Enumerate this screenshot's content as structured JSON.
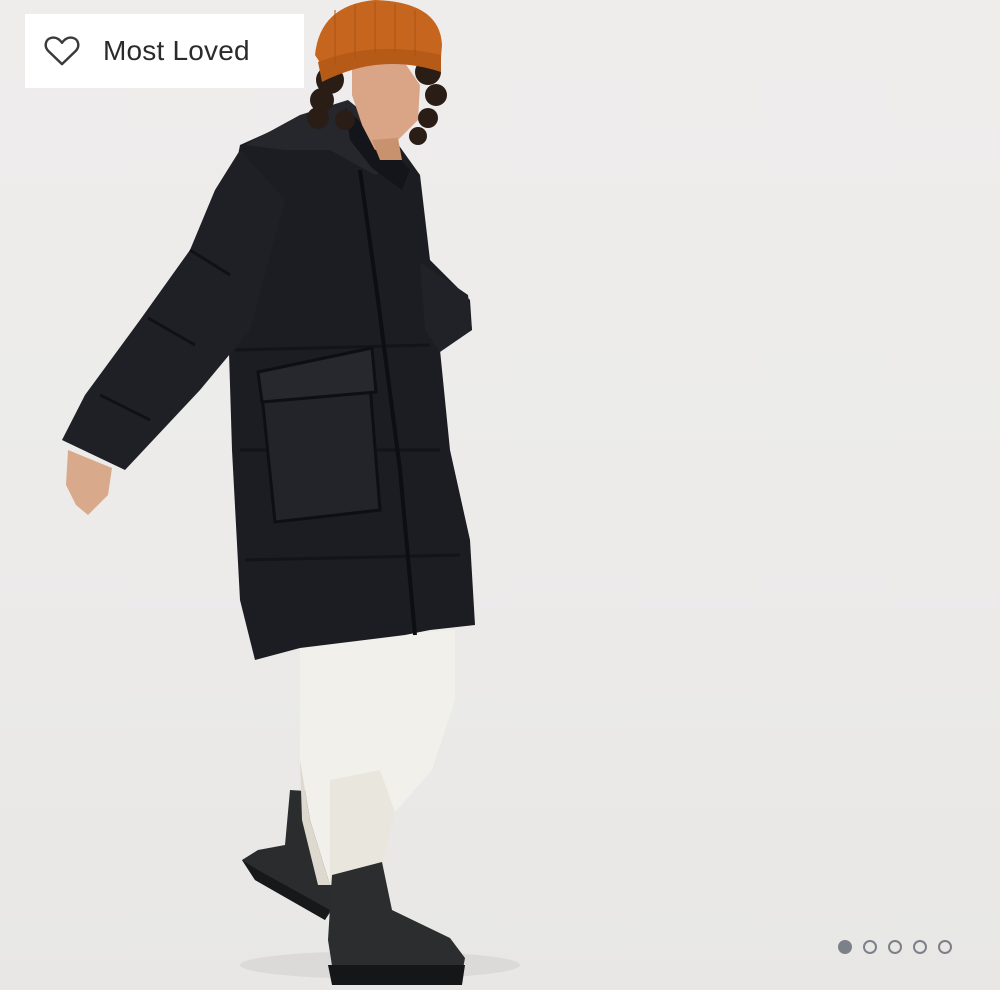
{
  "badge": {
    "label": "Most Loved",
    "icon": "heart-outline-icon"
  },
  "carousel": {
    "slide_count": 5,
    "active_index": 0,
    "indicator_color": "#7c8088"
  },
  "photo": {
    "subject": "product-model-photo"
  },
  "colors": {
    "background": "#eeedec",
    "coat": "#1b1d22",
    "beanie": "#c2651f",
    "pants": "#f1efe8",
    "boots": "#26282a"
  }
}
